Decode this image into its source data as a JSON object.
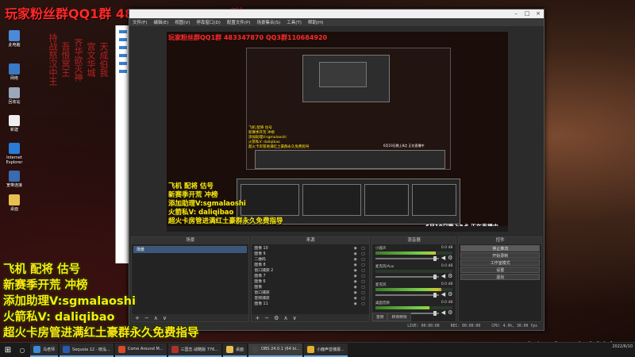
{
  "banner": "玩家粉丝群QQ1群 483347870 QQ3群110684920",
  "poem_columns": [
    "持战怒汉中王",
    "吾恨冥王",
    "齐华欲灭神",
    "宫文华城",
    "天成伯我"
  ],
  "side_lines": [
    "飞机  配将  估号",
    "新赛季开荒  冲榜",
    "添加助理V:sgmalaoshi",
    "火箭私V:  daliqibao",
    "超火卡房管进满红土豪群永久免费指导"
  ],
  "stream_time": "6月10日晚上8点   正在直播中",
  "desktop_icons": [
    "此电脑",
    "网络",
    "回收站",
    "新建",
    "Internet Explorer",
    "宽带连接",
    "桌面"
  ],
  "obs": {
    "title": "",
    "menu": [
      "文件(F)",
      "编辑(E)",
      "视图(V)",
      "停靠窗口(D)",
      "配置文件(P)",
      "场景集合(S)",
      "工具(T)",
      "帮助(H)"
    ],
    "docks": {
      "scenes": {
        "title": "场景",
        "items": [
          "场景"
        ]
      },
      "sources": {
        "title": "来源",
        "items": [
          "图像 10",
          "图像 9",
          "二维码",
          "图像 8",
          "窗口捕获 2",
          "图像 7",
          "图像 6",
          "图像",
          "窗口捕获",
          "音频捕获",
          "图像 11"
        ]
      },
      "mixer": {
        "title": "混音器",
        "channels": [
          {
            "name": "小鹿声",
            "db": "0.0 dB",
            "level": 0.78,
            "volume": 0.92
          },
          {
            "name": "麦克风/Aux",
            "db": "0.0 dB",
            "level": 0.0,
            "volume": 0.92
          },
          {
            "name": "麦克风",
            "db": "0.0 dB",
            "level": 0.85,
            "volume": 0.92
          },
          {
            "name": "桌面音频",
            "db": "0.0 dB",
            "level": 0.7,
            "volume": 0.92
          }
        ],
        "tabs": [
          "音频",
          "转场特效"
        ]
      },
      "controls": {
        "title": "控件",
        "buttons": [
          "停止推流",
          "开始录制",
          "工作室模式",
          "设置",
          "退出"
        ]
      }
    },
    "status": [
      "LIVE: 00:00:00",
      "REC: 00:00:00",
      "CPU: 4.9%, 30.00 fps"
    ]
  },
  "taskbar": {
    "items": [
      "乌老师",
      "Sequoia 12 - 晓泓...",
      "Come Around M...",
      "三国志·战略版 776...",
      "桌面",
      "OBS 24.0.1 (64 bi...",
      "小鹿声音播报..."
    ],
    "date": "2022/6/10"
  },
  "colors": {
    "banner_red": "#ff2a2a",
    "side_yellow": "#ffe814",
    "obs_bg": "#2b2b2b"
  }
}
